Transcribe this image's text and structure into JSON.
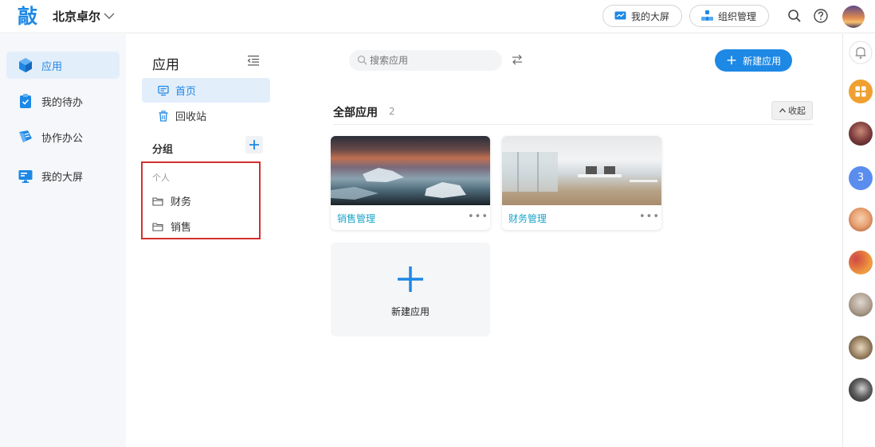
{
  "header": {
    "logo_char": "敲",
    "org_name": "北京卓尔",
    "big_screen_label": "我的大屏",
    "org_manage_label": "组织管理"
  },
  "leftnav": {
    "items": [
      {
        "label": "应用",
        "active": true
      },
      {
        "label": "我的待办",
        "active": false
      },
      {
        "label": "协作办公",
        "active": false
      },
      {
        "label": "我的大屏",
        "active": false
      }
    ]
  },
  "midcol": {
    "title": "应用",
    "items": [
      {
        "label": "首页",
        "active": true
      },
      {
        "label": "回收站",
        "active": false
      }
    ],
    "group_title": "分组",
    "personal_label": "个人",
    "folders": [
      "财务",
      "销售"
    ]
  },
  "main": {
    "search_placeholder": "搜索应用",
    "new_app_button": "新建应用",
    "section_title": "全部应用",
    "section_count": "2",
    "fold_label": "收起",
    "apps": [
      {
        "name": "销售管理",
        "more": "•••"
      },
      {
        "name": "财务管理",
        "more": "•••"
      }
    ],
    "new_card_label": "新建应用"
  },
  "rightrail": {
    "badge_number": "3"
  },
  "colors": {
    "accent": "#1e88e5",
    "app_name": "#1aa3c9",
    "highlight_border": "#d32f2f",
    "grid_orange": "#f0a030"
  }
}
